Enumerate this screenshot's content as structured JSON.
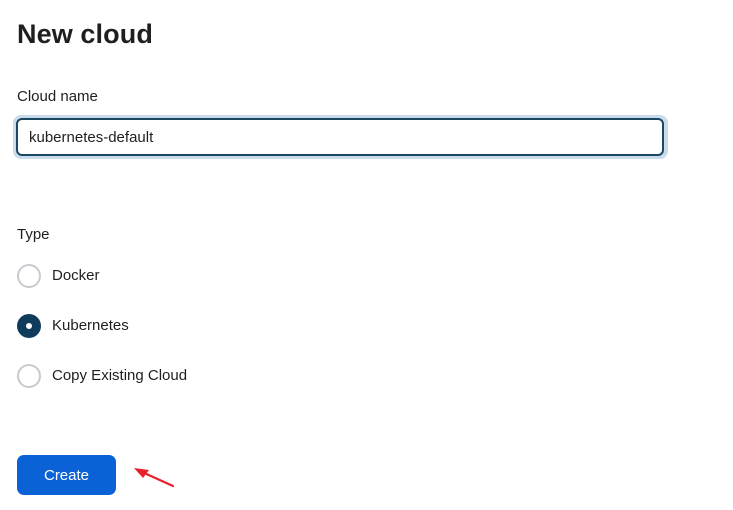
{
  "header": {
    "title": "New cloud"
  },
  "form": {
    "cloud_name_label": "Cloud name",
    "cloud_name_value": "kubernetes-default",
    "type_label": "Type",
    "type_options": [
      {
        "label": "Docker",
        "selected": false
      },
      {
        "label": "Kubernetes",
        "selected": true
      },
      {
        "label": "Copy Existing Cloud",
        "selected": false
      }
    ],
    "create_label": "Create"
  },
  "colors": {
    "accent": "#0b62d6",
    "radio_selected": "#0f3b5c",
    "annotation_arrow": "#e8202a"
  }
}
